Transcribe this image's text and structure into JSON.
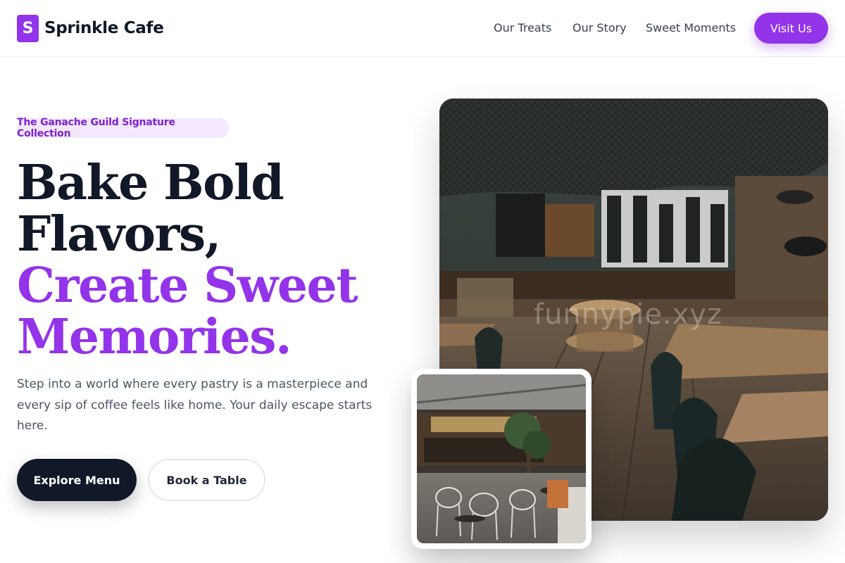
{
  "brand": {
    "initial": "S",
    "name": "Sprinkle Cafe"
  },
  "nav": {
    "items": [
      "Our Treats",
      "Our Story",
      "Sweet Moments"
    ],
    "cta": "Visit Us"
  },
  "hero": {
    "badge": "The Ganache Guild Signature Collection",
    "headline": {
      "line1": "Bake Bold",
      "line2": "Flavors,",
      "line3": "Create Sweet",
      "line4": "Memories."
    },
    "intro": "Step into a world where every pastry is a masterpiece and every sip of coffee feels like home. Your daily escape starts here.",
    "primary_button": "Explore Menu",
    "secondary_button": "Book a Table"
  },
  "images": {
    "watermark": "funnypie.xyz"
  },
  "colors": {
    "accent": "#9333ea",
    "dark": "#111827",
    "badge_bg": "#f3e8ff",
    "badge_text": "#7e22ce",
    "body_text": "#4b5563"
  }
}
